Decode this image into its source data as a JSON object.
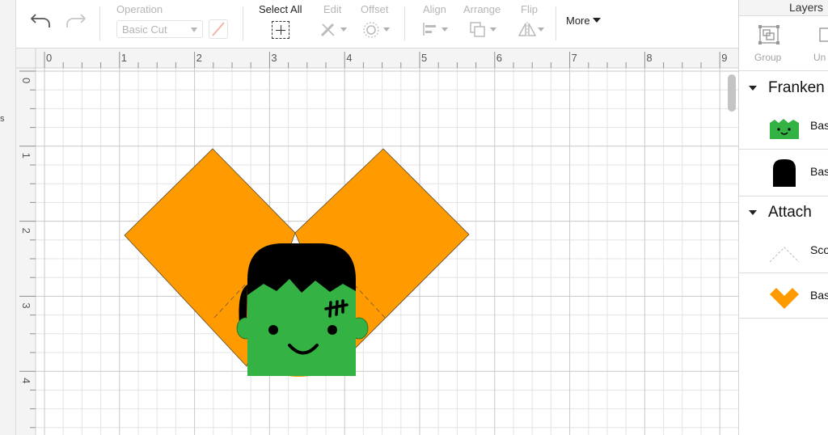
{
  "left_strip": {
    "cut_text": "s"
  },
  "toolbar": {
    "operation_label": "Operation",
    "operation_value": "Basic Cut",
    "select_all_label": "Select All",
    "edit_label": "Edit",
    "offset_label": "Offset",
    "align_label": "Align",
    "arrange_label": "Arrange",
    "flip_label": "Flip",
    "more_label": "More"
  },
  "rulers": {
    "horizontal": [
      "0",
      "1",
      "2",
      "3",
      "4",
      "5",
      "6",
      "7",
      "8",
      "9"
    ],
    "vertical": [
      "0",
      "1",
      "2",
      "3",
      "4"
    ]
  },
  "layers_panel": {
    "title": "Layers",
    "group_label": "Group",
    "ungroup_label": "Un",
    "groups": [
      {
        "name": "Franken",
        "items": [
          {
            "label": "Bas",
            "thumb": "frankenstein-face"
          },
          {
            "label": "Bas",
            "thumb": "black-head-shape"
          }
        ]
      },
      {
        "name": "Attach",
        "items": [
          {
            "label": "Sco",
            "thumb": "score-lines"
          },
          {
            "label": "Bas",
            "thumb": "orange-v-shape"
          }
        ]
      }
    ]
  },
  "colors": {
    "orange": "#FF9A00",
    "green": "#35B244",
    "black": "#000000",
    "grid_minor": "#e4e4e4",
    "grid_major": "#c9c9c9"
  }
}
